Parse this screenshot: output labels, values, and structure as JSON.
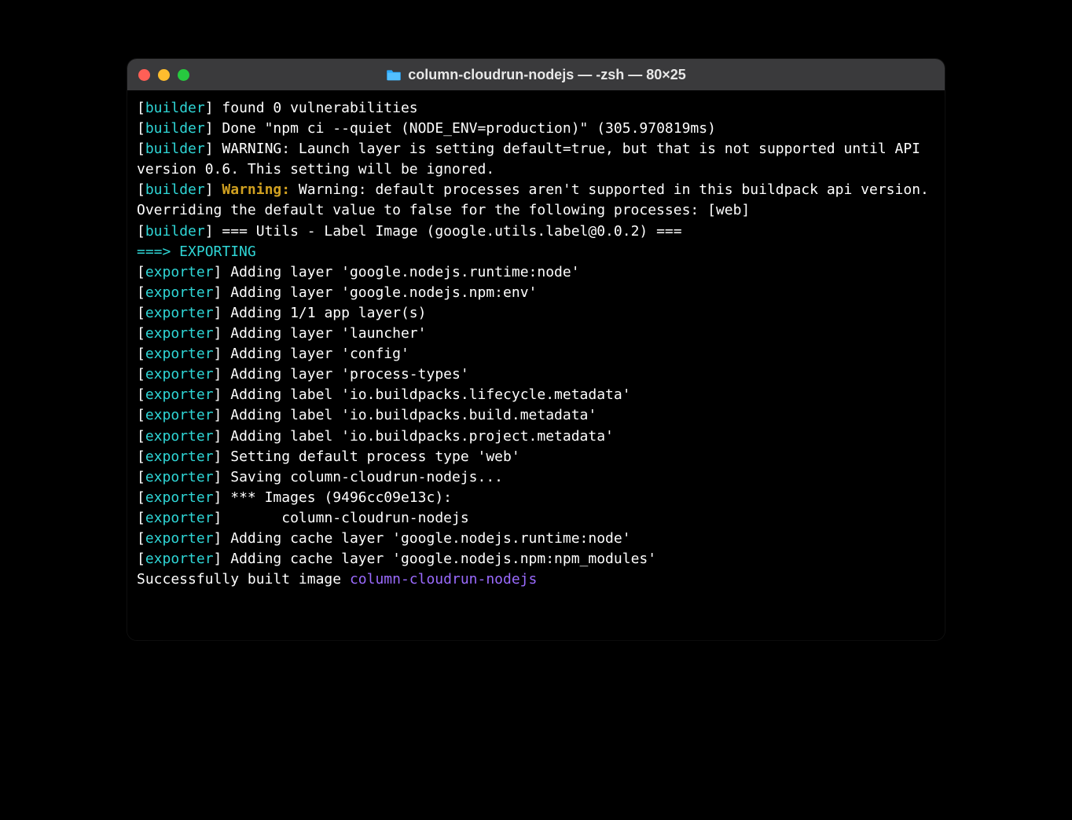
{
  "window": {
    "title": "column-cloudrun-nodejs — -zsh — 80×25"
  },
  "colors": {
    "tag": "#2fd6d6",
    "warn": "#d0a020",
    "image_name": "#9b6bff",
    "traffic_red": "#ff5f56",
    "traffic_yellow": "#ffbd2e",
    "traffic_green": "#27c93f",
    "titlebar_bg": "#3a3a3c"
  },
  "lines": [
    {
      "segments": [
        {
          "style": "bracket",
          "t": "["
        },
        {
          "style": "tag",
          "t": "builder"
        },
        {
          "style": "bracket",
          "t": "] "
        },
        {
          "style": "plain",
          "t": "found 0 vulnerabilities"
        }
      ]
    },
    {
      "segments": [
        {
          "style": "bracket",
          "t": "["
        },
        {
          "style": "tag",
          "t": "builder"
        },
        {
          "style": "bracket",
          "t": "] "
        },
        {
          "style": "plain",
          "t": "Done \"npm ci --quiet (NODE_ENV=production)\" (305.970819ms)"
        }
      ]
    },
    {
      "segments": [
        {
          "style": "bracket",
          "t": "["
        },
        {
          "style": "tag",
          "t": "builder"
        },
        {
          "style": "bracket",
          "t": "] "
        },
        {
          "style": "plain",
          "t": "WARNING: Launch layer is setting default=true, but that is not supported until API version 0.6. This setting will be ignored."
        }
      ]
    },
    {
      "segments": [
        {
          "style": "bracket",
          "t": "["
        },
        {
          "style": "tag",
          "t": "builder"
        },
        {
          "style": "bracket",
          "t": "] "
        },
        {
          "style": "warn",
          "t": "Warning:"
        },
        {
          "style": "plain",
          "t": " Warning: default processes aren't supported in this buildpack api version. Overriding the default value to false for the following processes: [web]"
        }
      ]
    },
    {
      "segments": [
        {
          "style": "bracket",
          "t": "["
        },
        {
          "style": "tag",
          "t": "builder"
        },
        {
          "style": "bracket",
          "t": "] "
        },
        {
          "style": "plain",
          "t": "=== Utils - Label Image (google.utils.label@0.0.2) ==="
        }
      ]
    },
    {
      "segments": [
        {
          "style": "stage",
          "t": "===> EXPORTING"
        }
      ]
    },
    {
      "segments": [
        {
          "style": "bracket",
          "t": "["
        },
        {
          "style": "tag",
          "t": "exporter"
        },
        {
          "style": "bracket",
          "t": "] "
        },
        {
          "style": "plain",
          "t": "Adding layer 'google.nodejs.runtime:node'"
        }
      ]
    },
    {
      "segments": [
        {
          "style": "bracket",
          "t": "["
        },
        {
          "style": "tag",
          "t": "exporter"
        },
        {
          "style": "bracket",
          "t": "] "
        },
        {
          "style": "plain",
          "t": "Adding layer 'google.nodejs.npm:env'"
        }
      ]
    },
    {
      "segments": [
        {
          "style": "bracket",
          "t": "["
        },
        {
          "style": "tag",
          "t": "exporter"
        },
        {
          "style": "bracket",
          "t": "] "
        },
        {
          "style": "plain",
          "t": "Adding 1/1 app layer(s)"
        }
      ]
    },
    {
      "segments": [
        {
          "style": "bracket",
          "t": "["
        },
        {
          "style": "tag",
          "t": "exporter"
        },
        {
          "style": "bracket",
          "t": "] "
        },
        {
          "style": "plain",
          "t": "Adding layer 'launcher'"
        }
      ]
    },
    {
      "segments": [
        {
          "style": "bracket",
          "t": "["
        },
        {
          "style": "tag",
          "t": "exporter"
        },
        {
          "style": "bracket",
          "t": "] "
        },
        {
          "style": "plain",
          "t": "Adding layer 'config'"
        }
      ]
    },
    {
      "segments": [
        {
          "style": "bracket",
          "t": "["
        },
        {
          "style": "tag",
          "t": "exporter"
        },
        {
          "style": "bracket",
          "t": "] "
        },
        {
          "style": "plain",
          "t": "Adding layer 'process-types'"
        }
      ]
    },
    {
      "segments": [
        {
          "style": "bracket",
          "t": "["
        },
        {
          "style": "tag",
          "t": "exporter"
        },
        {
          "style": "bracket",
          "t": "] "
        },
        {
          "style": "plain",
          "t": "Adding label 'io.buildpacks.lifecycle.metadata'"
        }
      ]
    },
    {
      "segments": [
        {
          "style": "bracket",
          "t": "["
        },
        {
          "style": "tag",
          "t": "exporter"
        },
        {
          "style": "bracket",
          "t": "] "
        },
        {
          "style": "plain",
          "t": "Adding label 'io.buildpacks.build.metadata'"
        }
      ]
    },
    {
      "segments": [
        {
          "style": "bracket",
          "t": "["
        },
        {
          "style": "tag",
          "t": "exporter"
        },
        {
          "style": "bracket",
          "t": "] "
        },
        {
          "style": "plain",
          "t": "Adding label 'io.buildpacks.project.metadata'"
        }
      ]
    },
    {
      "segments": [
        {
          "style": "bracket",
          "t": "["
        },
        {
          "style": "tag",
          "t": "exporter"
        },
        {
          "style": "bracket",
          "t": "] "
        },
        {
          "style": "plain",
          "t": "Setting default process type 'web'"
        }
      ]
    },
    {
      "segments": [
        {
          "style": "bracket",
          "t": "["
        },
        {
          "style": "tag",
          "t": "exporter"
        },
        {
          "style": "bracket",
          "t": "] "
        },
        {
          "style": "plain",
          "t": "Saving column-cloudrun-nodejs..."
        }
      ]
    },
    {
      "segments": [
        {
          "style": "bracket",
          "t": "["
        },
        {
          "style": "tag",
          "t": "exporter"
        },
        {
          "style": "bracket",
          "t": "] "
        },
        {
          "style": "plain",
          "t": "*** Images (9496cc09e13c):"
        }
      ]
    },
    {
      "segments": [
        {
          "style": "bracket",
          "t": "["
        },
        {
          "style": "tag",
          "t": "exporter"
        },
        {
          "style": "bracket",
          "t": "] "
        },
        {
          "style": "plain",
          "t": "      column-cloudrun-nodejs"
        }
      ]
    },
    {
      "segments": [
        {
          "style": "bracket",
          "t": "["
        },
        {
          "style": "tag",
          "t": "exporter"
        },
        {
          "style": "bracket",
          "t": "] "
        },
        {
          "style": "plain",
          "t": "Adding cache layer 'google.nodejs.runtime:node'"
        }
      ]
    },
    {
      "segments": [
        {
          "style": "bracket",
          "t": "["
        },
        {
          "style": "tag",
          "t": "exporter"
        },
        {
          "style": "bracket",
          "t": "] "
        },
        {
          "style": "plain",
          "t": "Adding cache layer 'google.nodejs.npm:npm_modules'"
        }
      ]
    },
    {
      "segments": [
        {
          "style": "plain",
          "t": "Successfully built image "
        },
        {
          "style": "imgname",
          "t": "column-cloudrun-nodejs"
        }
      ]
    }
  ]
}
